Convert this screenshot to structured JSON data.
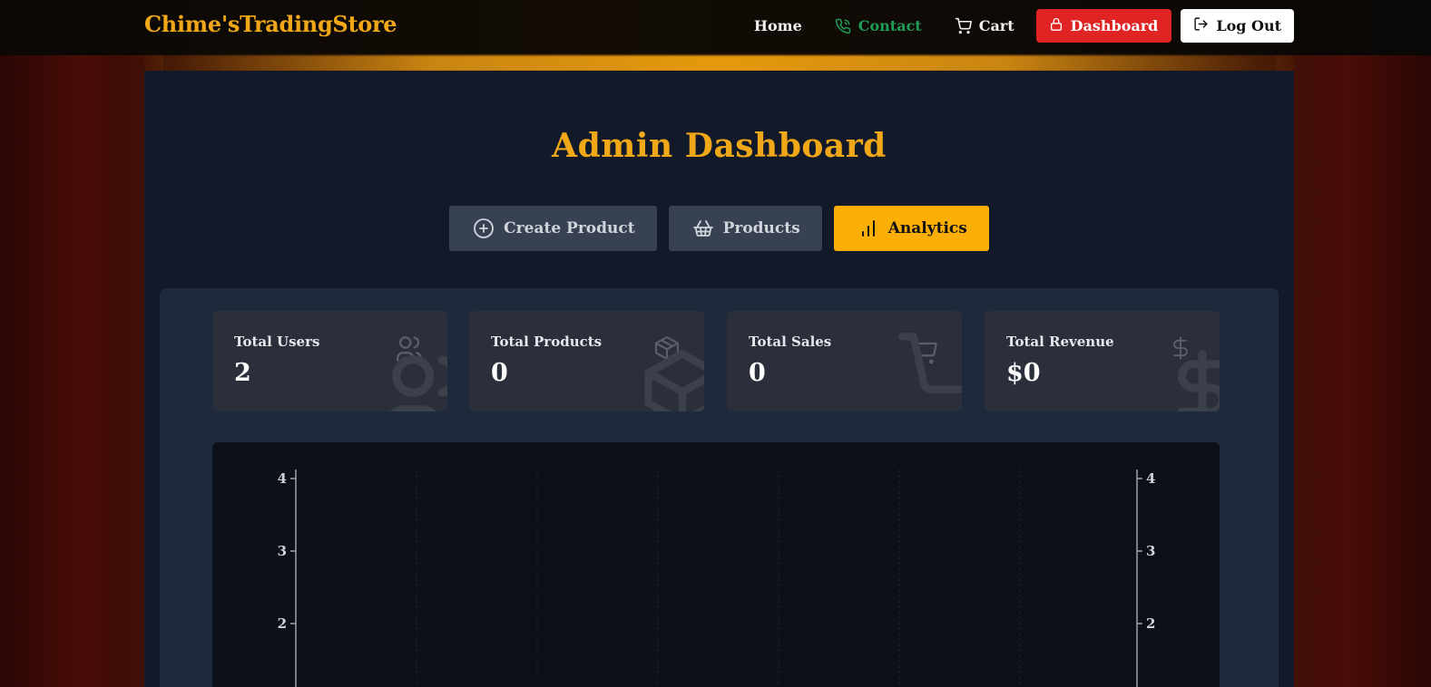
{
  "nav": {
    "brand": "Chime'sTradingStore",
    "home": "Home",
    "contact": "Contact",
    "cart": "Cart",
    "dashboard": "Dashboard",
    "logout": "Log Out"
  },
  "page": {
    "title": "Admin Dashboard"
  },
  "tabs": [
    {
      "label": "Create Product",
      "icon": "plus-circle-icon",
      "active": false
    },
    {
      "label": "Products",
      "icon": "basket-icon",
      "active": false
    },
    {
      "label": "Analytics",
      "icon": "bar-chart-icon",
      "active": true
    }
  ],
  "stats": [
    {
      "label": "Total Users",
      "value": "2",
      "icon": "users-icon"
    },
    {
      "label": "Total Products",
      "value": "0",
      "icon": "package-icon"
    },
    {
      "label": "Total Sales",
      "value": "0",
      "icon": "cart-icon"
    },
    {
      "label": "Total Revenue",
      "value": "$0",
      "icon": "dollar-icon"
    }
  ],
  "colors": {
    "accent": "#f0a818",
    "contact": "#1f9d57",
    "dashboard_button": "#e02424",
    "active_tab": "#fbae06"
  },
  "chart_data": {
    "type": "line",
    "left_axis_ticks": [
      "4",
      "3",
      "2"
    ],
    "right_axis_ticks": [
      "4",
      "3",
      "2"
    ],
    "ylim_visible": [
      2,
      4
    ],
    "grid": true
  }
}
